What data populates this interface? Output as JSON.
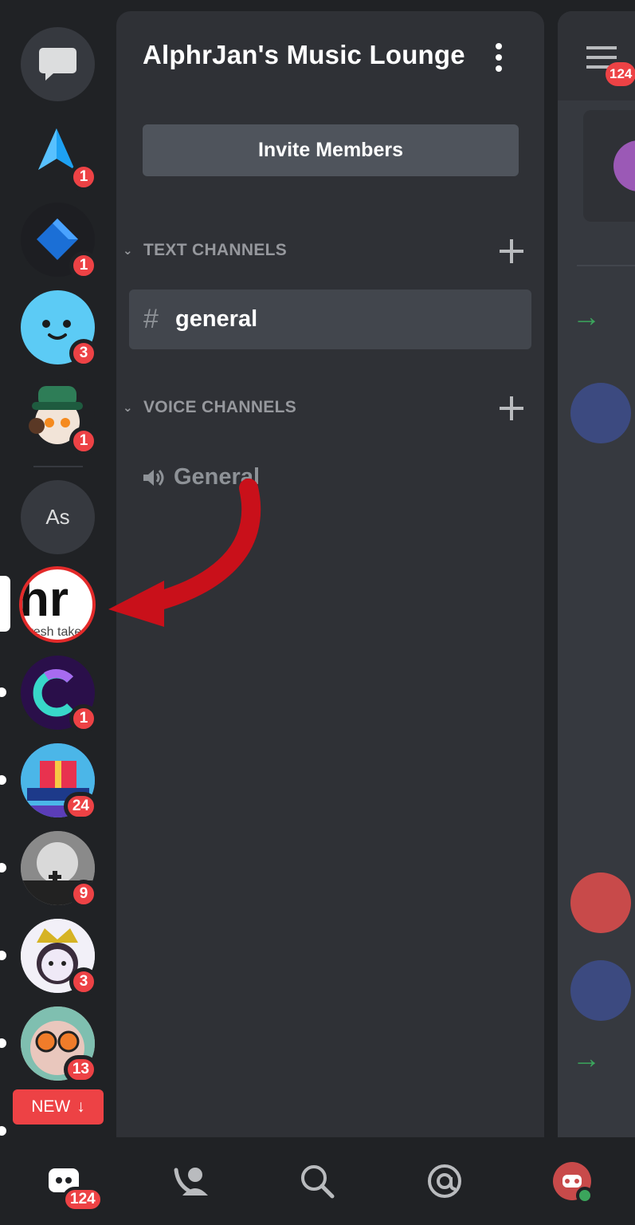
{
  "server": {
    "name": "AlphrJan's Music Lounge",
    "invite_label": "Invite Members"
  },
  "categories": {
    "text": "TEXT CHANNELS",
    "voice": "VOICE CHANNELS"
  },
  "channels": {
    "text": [
      {
        "name": "general",
        "selected": true
      }
    ],
    "voice": [
      {
        "name": "General"
      }
    ]
  },
  "rail": {
    "badges": [
      "1",
      "1",
      "3",
      "1",
      "1",
      "24",
      "9",
      "3",
      "13"
    ],
    "as_label": "As",
    "alphr_text": "fresh take"
  },
  "new_button": {
    "label": "NEW"
  },
  "bottom_nav": {
    "home_badge": "124"
  },
  "peek": {
    "badge": "124"
  },
  "colors": {
    "background": "#202225",
    "panel": "#2f3136",
    "selected_channel": "#42464d",
    "accent_red": "#ed4245",
    "button": "#4f545c"
  }
}
